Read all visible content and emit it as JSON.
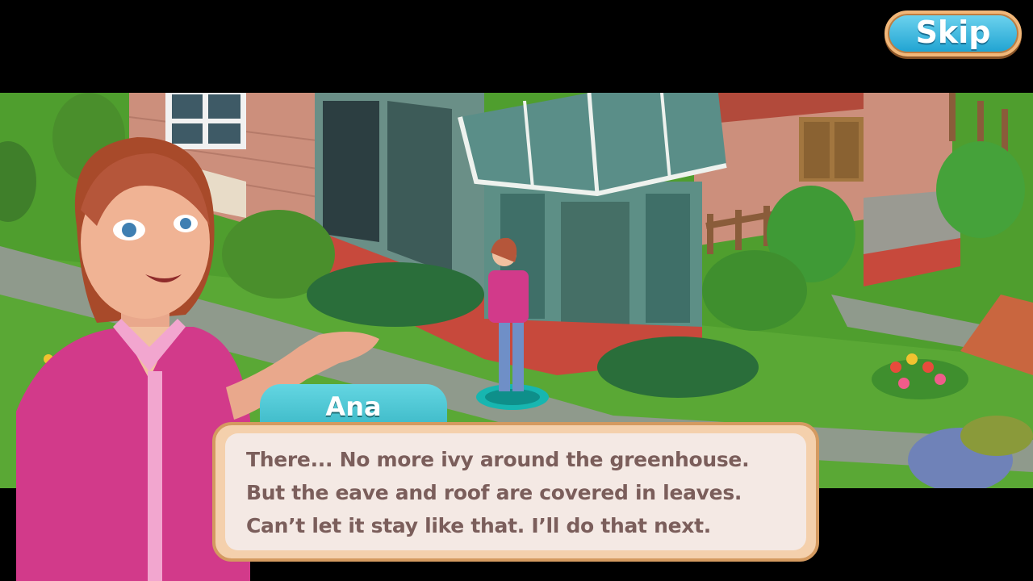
{
  "controls": {
    "skip_label": "Skip"
  },
  "dialog": {
    "speaker": "Ana",
    "lines": [
      "There... No more ivy around the greenhouse.",
      "But the eave and roof are covered in leaves.",
      "Can’t let it stay like that. I’ll do that next."
    ]
  },
  "colors": {
    "grass": "#4f9e2e",
    "path": "#8f9a8c",
    "house_wall": "#cc8f7c",
    "brick": "#c7493c",
    "glass": "#5d8f86",
    "skip_button": "#2fb2da",
    "name_tag": "#4cc7d3",
    "dialog_bg": "#f4e9e4",
    "dialog_text": "#7b5e5b",
    "shirt": "#d23a8a"
  },
  "icons": [
    "character-portrait",
    "greenhouse",
    "wheelbarrow",
    "flower-bed"
  ]
}
